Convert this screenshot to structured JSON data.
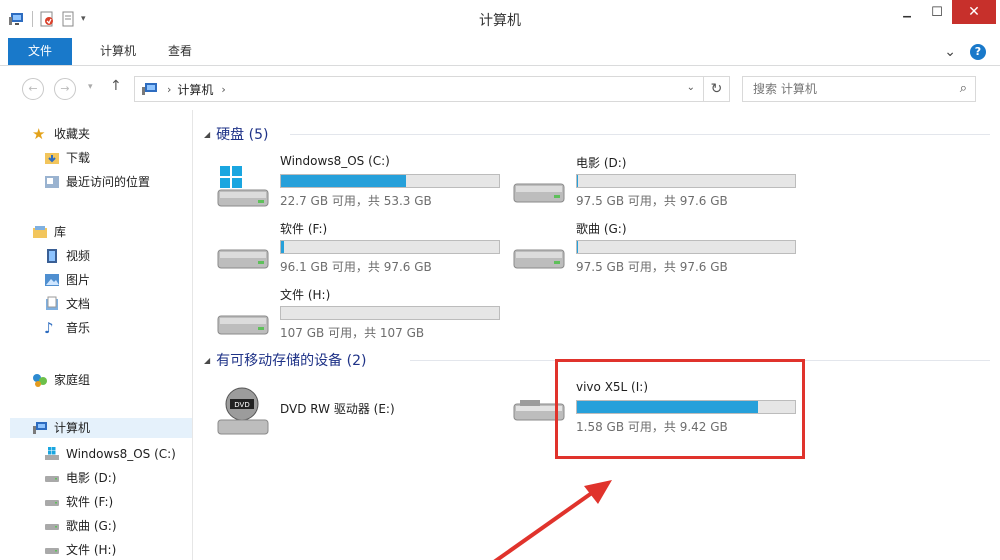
{
  "window": {
    "title": "计算机",
    "minimize": "▁",
    "maximize": "☐",
    "close": "✕"
  },
  "ribbon": {
    "file_tab": "文件",
    "tabs": [
      "计算机",
      "查看"
    ],
    "expand": "⌄",
    "help": "?"
  },
  "address": {
    "back": "←",
    "forward": "→",
    "up": "↑",
    "crumb": "计算机",
    "chevron": "›",
    "dropdown": "⌄",
    "refresh": "↻"
  },
  "search": {
    "placeholder": "搜索 计算机",
    "icon": "⌕"
  },
  "sidebar": {
    "favorites": "收藏夹",
    "downloads": "下载",
    "recent": "最近访问的位置",
    "libraries": "库",
    "videos": "视频",
    "pictures": "图片",
    "documents": "文档",
    "music": "音乐",
    "homegroup": "家庭组",
    "computer": "计算机",
    "drives": [
      "Windows8_OS (C:)",
      "电影 (D:)",
      "软件 (F:)",
      "歌曲 (G:)",
      "文件 (H:)"
    ]
  },
  "groups": {
    "hard_disks": "硬盘 (5)",
    "removable": "有可移动存储的设备 (2)"
  },
  "drives": [
    {
      "name": "Windows8_OS (C:)",
      "info": "22.7 GB 可用，共 53.3 GB",
      "used_fraction": 0.574,
      "type": "os"
    },
    {
      "name": "电影 (D:)",
      "info": "97.5 GB 可用，共 97.6 GB",
      "used_fraction": 0.001,
      "type": "hdd"
    },
    {
      "name": "软件 (F:)",
      "info": "96.1 GB 可用，共 97.6 GB",
      "used_fraction": 0.015,
      "type": "hdd"
    },
    {
      "name": "歌曲 (G:)",
      "info": "97.5 GB 可用，共 97.6 GB",
      "used_fraction": 0.001,
      "type": "hdd"
    },
    {
      "name": "文件 (H:)",
      "info": "107 GB 可用，共 107 GB",
      "used_fraction": 0.0,
      "type": "hdd"
    }
  ],
  "removable": [
    {
      "name": "DVD RW 驱动器 (E:)",
      "type": "dvd"
    },
    {
      "name": "vivo X5L (I:)",
      "info": "1.58 GB 可用，共 9.42 GB",
      "used_fraction": 0.832,
      "type": "usb"
    }
  ],
  "colors": {
    "accent": "#1979ca",
    "bar_fill": "#26a0da",
    "highlight": "#e0332c",
    "group_text": "#1e3287"
  }
}
